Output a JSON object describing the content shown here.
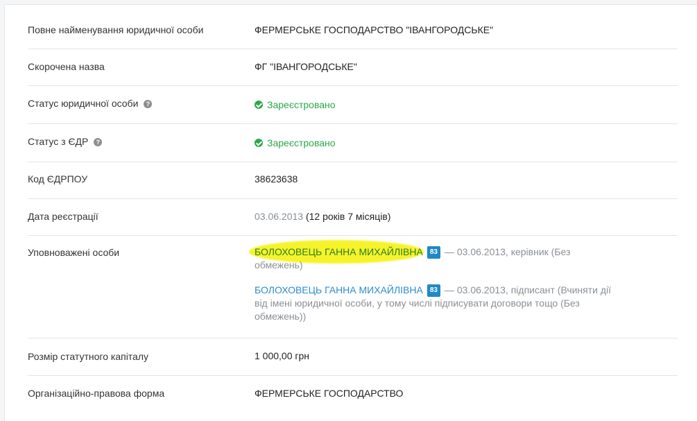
{
  "rows": {
    "full_name": {
      "label": "Повне найменування юридичної особи",
      "value": "ФЕРМЕРСЬКЕ ГОСПОДАРСТВО \"ІВАНГОРОДСЬКЕ\""
    },
    "short_name": {
      "label": "Скорочена назва",
      "value": "ФГ \"ІВАНГОРОДСЬКЕ\""
    },
    "legal_status": {
      "label": "Статус юридичної особи",
      "help": "?",
      "value": "Зареєстровано"
    },
    "edr_status": {
      "label": "Статус з ЄДР",
      "help": "?",
      "value": "Зареєстровано"
    },
    "edrpou": {
      "label": "Код ЄДРПОУ",
      "value": "38623638"
    },
    "registration_date": {
      "label": "Дата реєстрації",
      "date": "03.06.2013",
      "duration": "(12 років 7 місяців)"
    },
    "authorized_persons": {
      "label": "Уповноважені особи",
      "persons": [
        {
          "name": "БОЛОХОВЕЦЬ ГАННА МИХАЙЛІВНА",
          "badge": "83",
          "details_line1": "— 03.06.2013, керівник (Без",
          "details_line2": "обмежень)"
        },
        {
          "name": "БОЛОХОВЕЦЬ ГАННА МИХАЙЛІВНА",
          "badge": "83",
          "details_line1": "— 03.06.2013, підписант (Вчиняти дії",
          "details_line2": "від імені юридичної особи, у тому числі підписувати договори тощо (Без",
          "details_line3": "обмежень))"
        }
      ]
    },
    "capital": {
      "label": "Розмір статутного капіталу",
      "value": "1 000,00 грн"
    },
    "legal_form": {
      "label": "Організаційно-правова форма",
      "value": "ФЕРМЕРСЬКЕ ГОСПОДАРСТВО"
    }
  },
  "colors": {
    "status_green": "#2aa84a",
    "link_blue": "#2a8ccf",
    "badge_blue": "#1f88c8",
    "highlight_yellow": "#f6f32a",
    "muted_grey": "#8a8f95"
  }
}
